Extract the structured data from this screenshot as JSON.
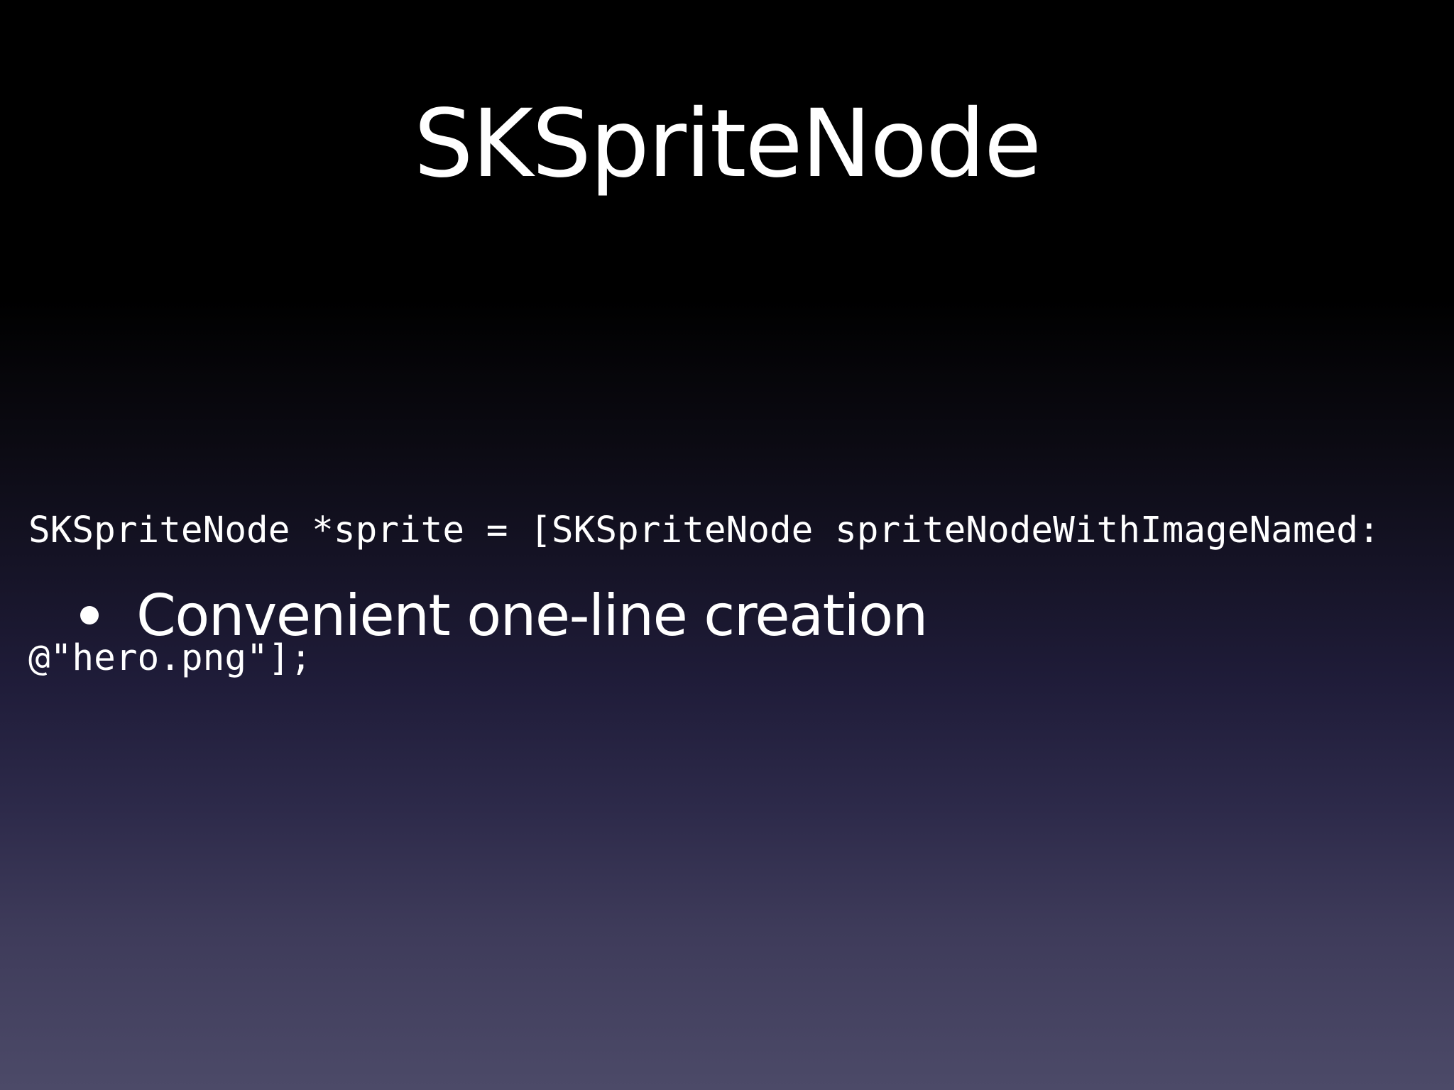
{
  "slide": {
    "title": "SKSpriteNode",
    "code_lines": [
      "SKSpriteNode *sprite = [SKSpriteNode spriteNodeWithImageNamed:",
      "@\"hero.png\"];"
    ],
    "bullets": [
      {
        "text": "Convenient one-line creation"
      }
    ],
    "colors": {
      "text": "#ffffff",
      "background_top": "#000000",
      "background_bottom": "#4c4a68"
    }
  }
}
